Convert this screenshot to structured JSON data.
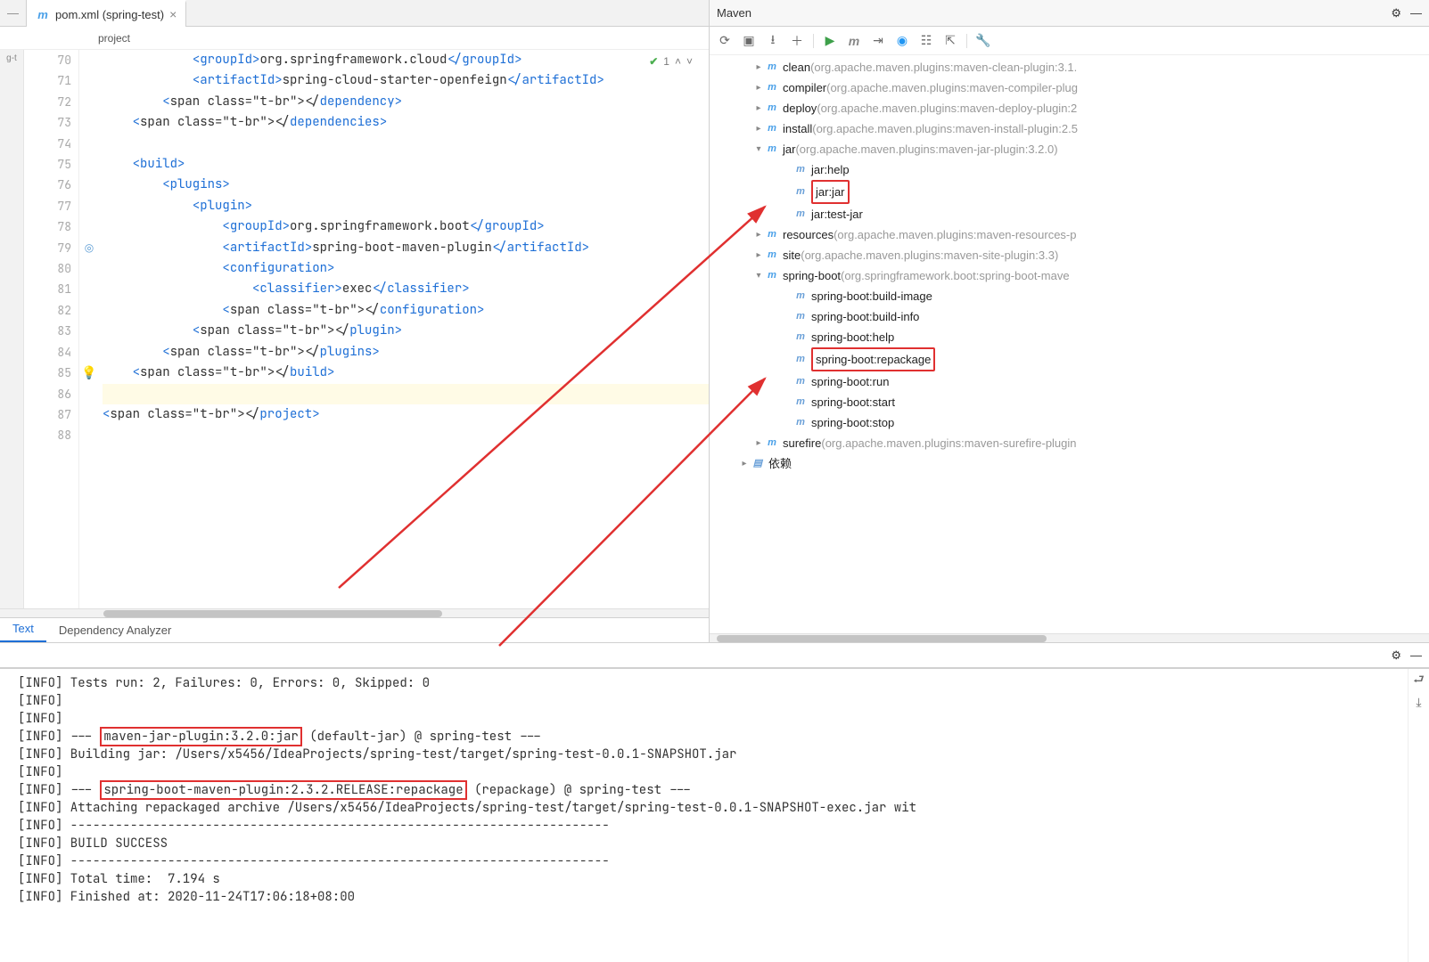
{
  "tab": {
    "filename": "pom.xml (spring-test)"
  },
  "breadcrumb": "project",
  "hint": {
    "count": "1"
  },
  "gutter": {
    "start": 70,
    "end": 88
  },
  "code": {
    "l70": {
      "pre": "            <",
      "tag1": "groupId",
      "mid": ">org.springframework.cloud</",
      "tag2": "groupId",
      "post": ">"
    },
    "l71": {
      "pre": "            <",
      "tag1": "artifactId",
      "mid": ">spring-cloud-starter-openfeign</",
      "tag2": "artifactId",
      "post": ">"
    },
    "l72": {
      "pre": "        </",
      "tag": "dependency",
      "post": ">"
    },
    "l73": {
      "pre": "    </",
      "tag": "dependencies",
      "post": ">"
    },
    "l74": "",
    "l75": {
      "pre": "    <",
      "tag": "build",
      "post": ">"
    },
    "l76": {
      "pre": "        <",
      "tag": "plugins",
      "post": ">"
    },
    "l77": {
      "pre": "            <",
      "tag": "plugin",
      "post": ">"
    },
    "l78": {
      "pre": "                <",
      "tag1": "groupId",
      "mid": ">org.springframework.boot</",
      "tag2": "groupId",
      "post": ">"
    },
    "l79": {
      "pre": "                <",
      "tag1": "artifactId",
      "mid": ">spring-boot-maven-plugin</",
      "tag2": "artifactId",
      "post": ">"
    },
    "l80": {
      "pre": "                <",
      "tag": "configuration",
      "post": ">"
    },
    "l81": {
      "pre": "                    <",
      "tag1": "classifier",
      "mid": ">exec</",
      "tag2": "classifier",
      "post": ">"
    },
    "l82": {
      "pre": "                </",
      "tag": "configuration",
      "post": ">"
    },
    "l83": {
      "pre": "            </",
      "tag": "plugin",
      "post": ">"
    },
    "l84": {
      "pre": "        </",
      "tag": "plugins",
      "post": ">"
    },
    "l85": {
      "pre": "    </",
      "tag": "build",
      "post": ">"
    },
    "l86": "",
    "l87": {
      "pre": "</",
      "tag": "project",
      "post": ">"
    },
    "l88": ""
  },
  "editor_tabs": {
    "text": "Text",
    "dep": "Dependency Analyzer"
  },
  "maven": {
    "title": "Maven",
    "tree": [
      {
        "indent": 3,
        "arrow": ">",
        "icon": "p",
        "label": "clean",
        "meta": " (org.apache.maven.plugins:maven-clean-plugin:3.1."
      },
      {
        "indent": 3,
        "arrow": ">",
        "icon": "p",
        "label": "compiler",
        "meta": " (org.apache.maven.plugins:maven-compiler-plug"
      },
      {
        "indent": 3,
        "arrow": ">",
        "icon": "p",
        "label": "deploy",
        "meta": " (org.apache.maven.plugins:maven-deploy-plugin:2"
      },
      {
        "indent": 3,
        "arrow": ">",
        "icon": "p",
        "label": "install",
        "meta": " (org.apache.maven.plugins:maven-install-plugin:2.5"
      },
      {
        "indent": 3,
        "arrow": "v",
        "icon": "p",
        "label": "jar",
        "meta": " (org.apache.maven.plugins:maven-jar-plugin:3.2.0)"
      },
      {
        "indent": 5,
        "arrow": "",
        "icon": "g",
        "label": "jar:help",
        "meta": ""
      },
      {
        "indent": 5,
        "arrow": "",
        "icon": "g",
        "label": "jar:jar",
        "meta": "",
        "boxed": true
      },
      {
        "indent": 5,
        "arrow": "",
        "icon": "g",
        "label": "jar:test-jar",
        "meta": ""
      },
      {
        "indent": 3,
        "arrow": ">",
        "icon": "p",
        "label": "resources",
        "meta": " (org.apache.maven.plugins:maven-resources-p"
      },
      {
        "indent": 3,
        "arrow": ">",
        "icon": "p",
        "label": "site",
        "meta": " (org.apache.maven.plugins:maven-site-plugin:3.3)"
      },
      {
        "indent": 3,
        "arrow": "v",
        "icon": "p",
        "label": "spring-boot",
        "meta": " (org.springframework.boot:spring-boot-mave"
      },
      {
        "indent": 5,
        "arrow": "",
        "icon": "g",
        "label": "spring-boot:build-image",
        "meta": ""
      },
      {
        "indent": 5,
        "arrow": "",
        "icon": "g",
        "label": "spring-boot:build-info",
        "meta": ""
      },
      {
        "indent": 5,
        "arrow": "",
        "icon": "g",
        "label": "spring-boot:help",
        "meta": ""
      },
      {
        "indent": 5,
        "arrow": "",
        "icon": "g",
        "label": "spring-boot:repackage",
        "meta": "",
        "boxed": true
      },
      {
        "indent": 5,
        "arrow": "",
        "icon": "g",
        "label": "spring-boot:run",
        "meta": ""
      },
      {
        "indent": 5,
        "arrow": "",
        "icon": "g",
        "label": "spring-boot:start",
        "meta": ""
      },
      {
        "indent": 5,
        "arrow": "",
        "icon": "g",
        "label": "spring-boot:stop",
        "meta": ""
      },
      {
        "indent": 3,
        "arrow": ">",
        "icon": "p",
        "label": "surefire",
        "meta": " (org.apache.maven.plugins:maven-surefire-plugin"
      },
      {
        "indent": 2,
        "arrow": ">",
        "icon": "f",
        "label": "依赖",
        "meta": ""
      }
    ]
  },
  "console": {
    "lines": [
      "[INFO] Tests run: 2, Failures: 0, Errors: 0, Skipped: 0",
      "[INFO] ",
      "[INFO] ",
      "[INFO] --- |maven-jar-plugin:3.2.0:jar| (default-jar) @ spring-test ---",
      "[INFO] Building jar: /Users/x5456/IdeaProjects/spring-test/target/spring-test-0.0.1-SNAPSHOT.jar",
      "[INFO] ",
      "[INFO] --- |spring-boot-maven-plugin:2.3.2.RELEASE:repackage| (repackage) @ spring-test ---",
      "[INFO] Attaching repackaged archive /Users/x5456/IdeaProjects/spring-test/target/spring-test-0.0.1-SNAPSHOT-exec.jar wit",
      "[INFO] ------------------------------------------------------------------------",
      "[INFO] BUILD SUCCESS",
      "[INFO] ------------------------------------------------------------------------",
      "[INFO] Total time:  7.194 s",
      "[INFO] Finished at: 2020-11-24T17:06:18+08:00"
    ]
  }
}
